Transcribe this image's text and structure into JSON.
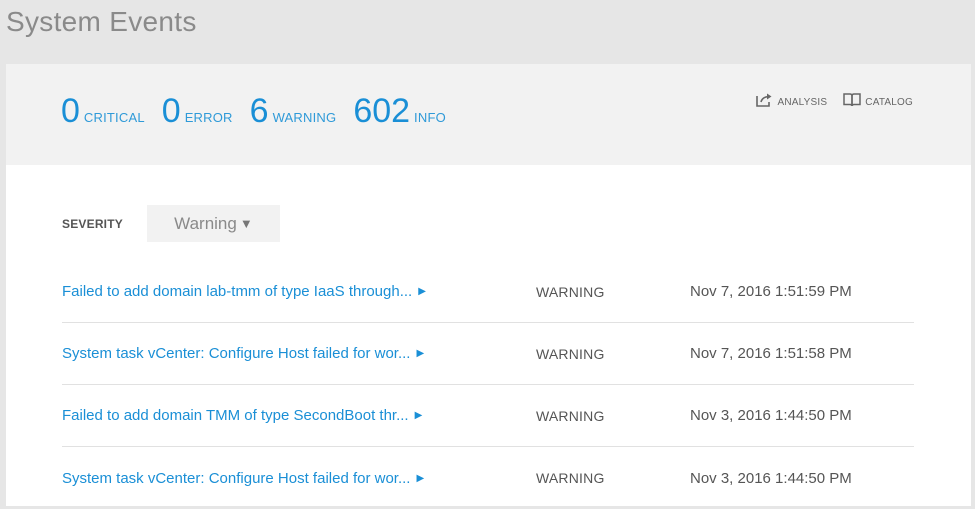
{
  "page": {
    "title": "System Events"
  },
  "summary": {
    "counts": [
      {
        "value": "0",
        "label": "CRITICAL"
      },
      {
        "value": "0",
        "label": "ERROR"
      },
      {
        "value": "6",
        "label": "WARNING"
      },
      {
        "value": "602",
        "label": "INFO"
      }
    ],
    "accent_color": "#1a8fd6"
  },
  "actions": {
    "analysis": {
      "label": "ANALYSIS",
      "icon": "share-export-icon"
    },
    "catalog": {
      "label": "CATALOG",
      "icon": "book-icon"
    }
  },
  "filter": {
    "label": "SEVERITY",
    "selected": "Warning",
    "caret": "▼"
  },
  "events": [
    {
      "title": "Failed to add domain lab-tmm of type IaaS through...",
      "severity": "WARNING",
      "time": "Nov 7, 2016 1:51:59 PM"
    },
    {
      "title": "System task vCenter: Configure Host failed for wor...",
      "severity": "WARNING",
      "time": "Nov 7, 2016 1:51:58 PM"
    },
    {
      "title": "Failed to add domain TMM of type SecondBoot thr...",
      "severity": "WARNING",
      "time": "Nov 3, 2016 1:44:50 PM"
    },
    {
      "title": "System task vCenter: Configure Host failed for wor...",
      "severity": "WARNING",
      "time": "Nov 3, 2016 1:44:50 PM"
    }
  ]
}
